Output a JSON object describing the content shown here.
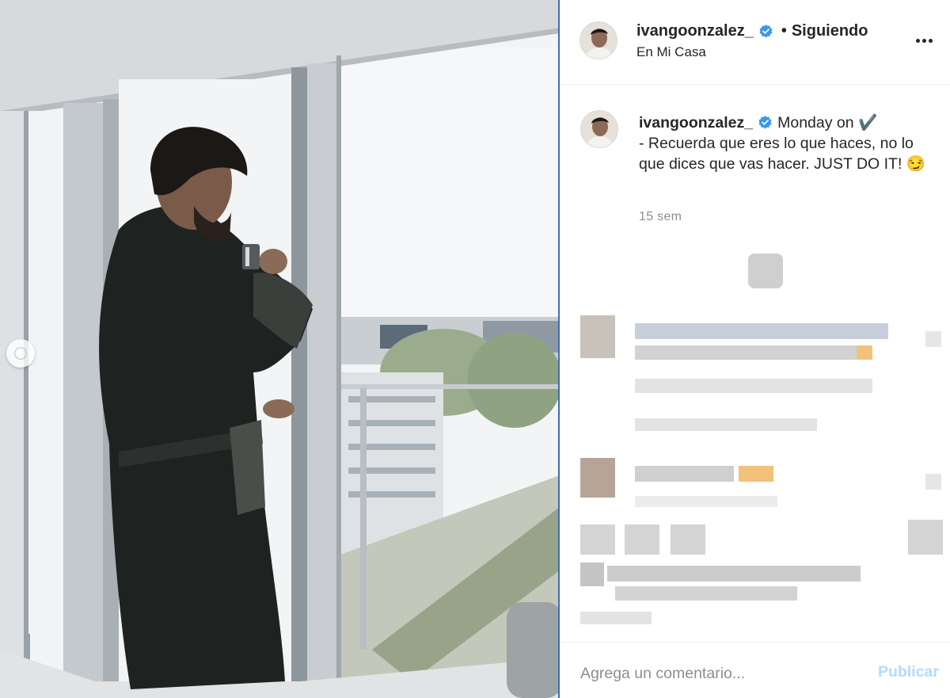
{
  "post": {
    "username": "ivangoonzalez_",
    "separator": "•",
    "follow_label": "Siguiendo",
    "location": "En Mi Casa",
    "caption_line1": "Monday on ✔️",
    "caption_body": "- Recuerda que eres lo que haces, no lo que dices que vas hacer. JUST DO IT! 😏",
    "time_ago": "15 sem"
  },
  "comment_box": {
    "placeholder": "Agrega un comentario...",
    "publish_label": "Publicar"
  },
  "icons": {
    "verified": "verified-badge-icon",
    "more": "more-options-icon",
    "carousel_prev": "chevron-left-icon"
  },
  "colors": {
    "verified_blue": "#3897f0",
    "publish_disabled": "#b3dbff",
    "meta_gray": "#8e8e8e"
  }
}
